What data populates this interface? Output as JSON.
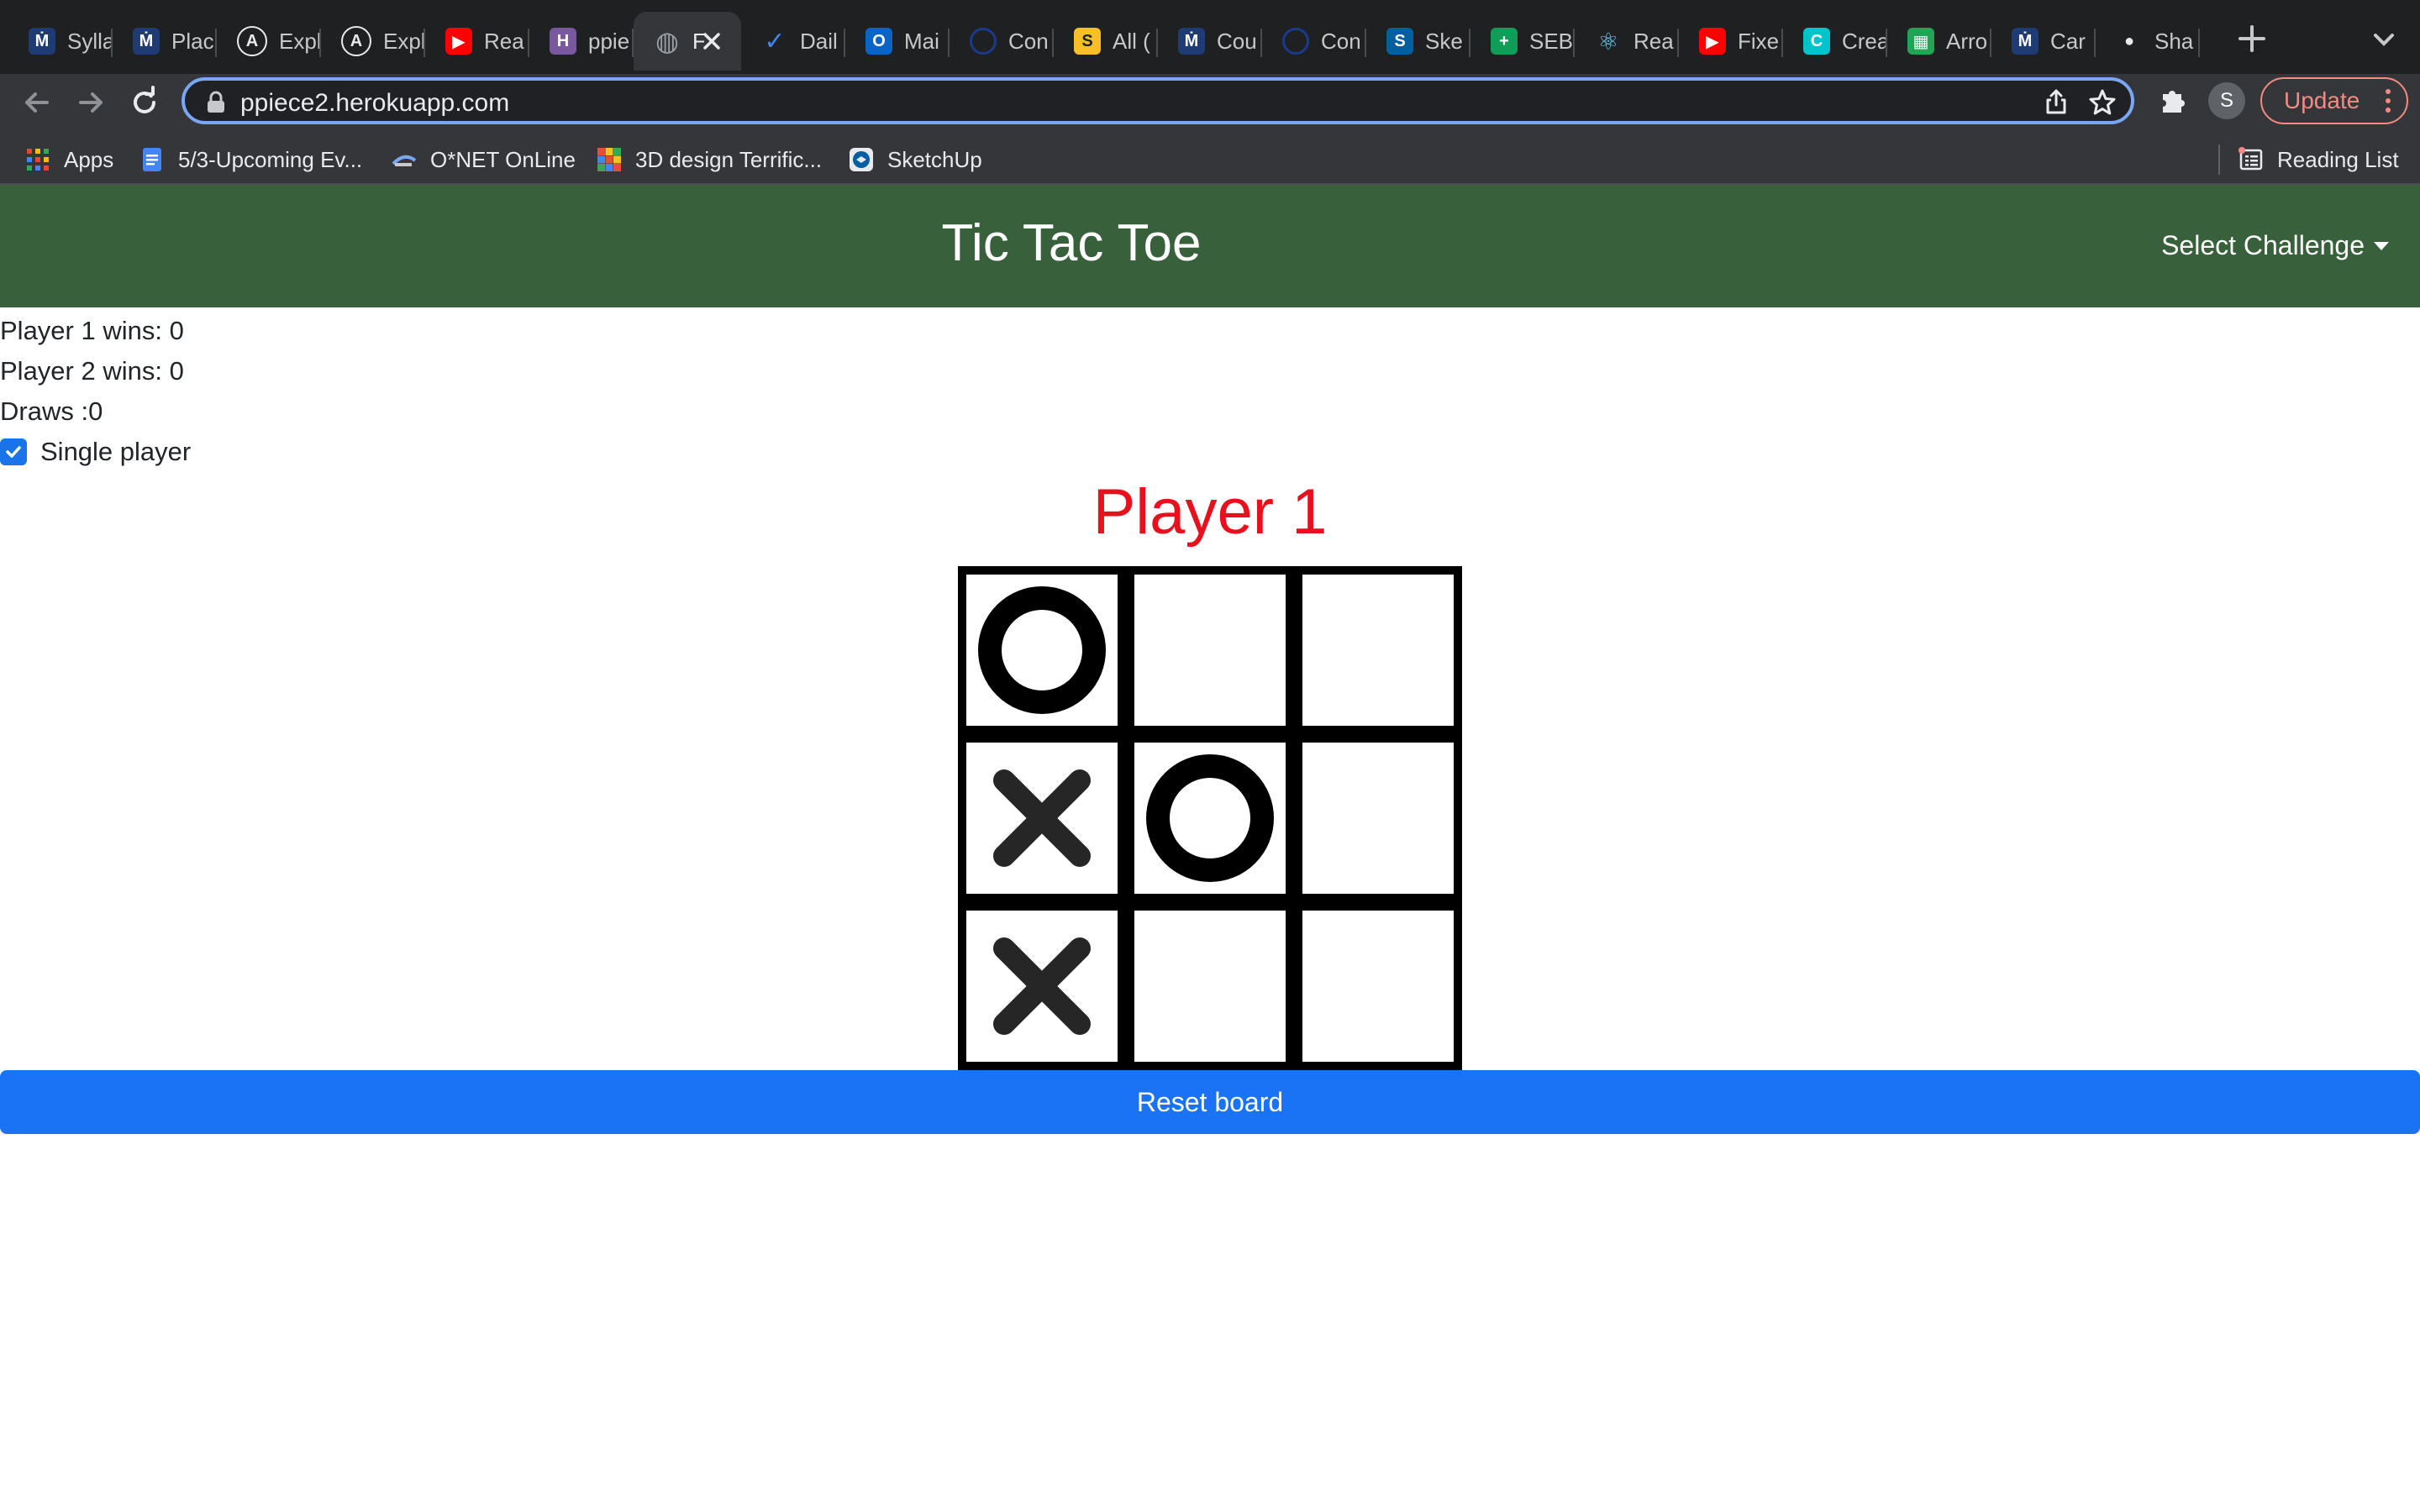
{
  "browser": {
    "tabs": [
      {
        "title": "Sylla",
        "icon": "university-icon",
        "color": "#1f3b73"
      },
      {
        "title": "Plac",
        "icon": "university-icon",
        "color": "#1f3b73"
      },
      {
        "title": "Expl",
        "icon": "angular-icon",
        "color": "#e8eaed"
      },
      {
        "title": "Expl",
        "icon": "angular-icon",
        "color": "#e8eaed"
      },
      {
        "title": "Rea",
        "icon": "youtube-icon",
        "color": "#ff0000"
      },
      {
        "title": "ppie",
        "icon": "heroku-icon",
        "color": "#79589f"
      },
      {
        "title": "F",
        "icon": "globe-icon",
        "color": "#9aa0a6",
        "active": true
      },
      {
        "title": "Dail",
        "icon": "checkmark-icon",
        "color": "#4285f4"
      },
      {
        "title": "Mai",
        "icon": "outlook-icon",
        "color": "#0a64c8"
      },
      {
        "title": "Con",
        "icon": "circle-icon",
        "color": "#1a3a8a"
      },
      {
        "title": "All (",
        "icon": "document-icon",
        "color": "#f6c026"
      },
      {
        "title": "Cou",
        "icon": "university-icon",
        "color": "#1f3b73"
      },
      {
        "title": "Con",
        "icon": "circle-icon",
        "color": "#1a3a8a"
      },
      {
        "title": "Ske",
        "icon": "sketchup-icon",
        "color": "#005f9e"
      },
      {
        "title": "SEB",
        "icon": "sheets-icon",
        "color": "#0f9d58"
      },
      {
        "title": "Rea",
        "icon": "react-icon",
        "color": "#61dafb"
      },
      {
        "title": "Fixe",
        "icon": "youtube-icon",
        "color": "#ff0000"
      },
      {
        "title": "Crea",
        "icon": "canva-icon",
        "color": "#00c4cc"
      },
      {
        "title": "Arro",
        "icon": "apps-icon",
        "color": "#23a455"
      },
      {
        "title": "Car",
        "icon": "university-icon",
        "color": "#1f3b73"
      },
      {
        "title": "Sha",
        "icon": "github-icon",
        "color": "#e8eaed"
      }
    ],
    "url": "ppiece2.herokuapp.com",
    "profile_initial": "S",
    "update_label": "Update",
    "bookmarks": [
      {
        "label": "Apps",
        "icon": "apps-grid-icon"
      },
      {
        "label": "5/3-Upcoming Ev...",
        "icon": "docs-icon"
      },
      {
        "label": "O*NET OnLine",
        "icon": "onet-icon"
      },
      {
        "label": "3D design Terrific...",
        "icon": "tinkercad-icon"
      },
      {
        "label": "SketchUp",
        "icon": "sketchup-icon"
      }
    ],
    "reading_list_label": "Reading List"
  },
  "page": {
    "title": "Tic Tac Toe",
    "challenge_label": "Select Challenge",
    "stats": {
      "p1": "Player 1 wins: 0",
      "p2": "Player 2 wins: 0",
      "draws": "Draws :0"
    },
    "single_player": {
      "label": "Single player",
      "checked": true
    },
    "turn_label": "Player 1",
    "board": [
      "O",
      "",
      "",
      "X",
      "O",
      "",
      "X",
      "",
      ""
    ],
    "reset_label": "Reset board",
    "colors": {
      "header_bg": "#37603b",
      "turn_text": "#e8101d",
      "reset_bg": "#1a73f4"
    }
  }
}
